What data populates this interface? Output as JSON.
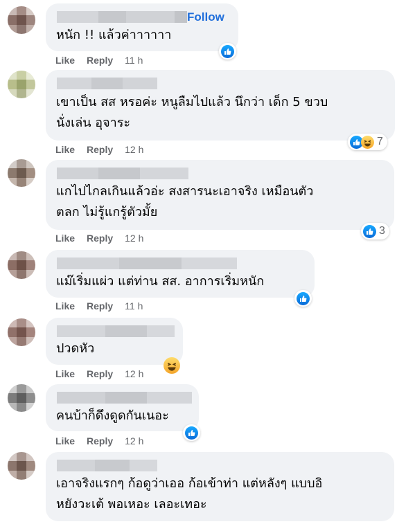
{
  "follow_label": "Follow",
  "comments": [
    {
      "text_lines": [
        "หนัก !! แล้วค่าาาาาา"
      ],
      "like_label": "Like",
      "reply_label": "Reply",
      "time": "11 h",
      "reaction_count": ""
    },
    {
      "text_lines": [
        "เขาเป็น สส หรอค่ะ หนูลืมไปแล้ว นึกว่า เด็ก 5 ขวบ",
        "นั่งเล่น อุจาระ"
      ],
      "like_label": "Like",
      "reply_label": "Reply",
      "time": "12 h",
      "reaction_count": "7"
    },
    {
      "text_lines": [
        "แกไปไกลเกินแล้วอ่ะ สงสารนะเอาจริง เหมือนตัว",
        "ตลก ไม่รู้แกรู้ตัวมั้ย"
      ],
      "like_label": "Like",
      "reply_label": "Reply",
      "time": "12 h",
      "reaction_count": "3"
    },
    {
      "text_lines": [
        "แม๊เริ่มแผ่ว แต่ท่าน สส. อาการเริ่มหนัก"
      ],
      "like_label": "Like",
      "reply_label": "Reply",
      "time": "11 h",
      "reaction_count": ""
    },
    {
      "text_lines": [
        "ปวดหัว"
      ],
      "like_label": "Like",
      "reply_label": "Reply",
      "time": "12 h",
      "reaction_count": ""
    },
    {
      "text_lines": [
        "คนบ้าก็ดึงดูดกันเนอะ"
      ],
      "like_label": "Like",
      "reply_label": "Reply",
      "time": "12 h",
      "reaction_count": ""
    },
    {
      "text_lines": [
        "เอาจริงแรกๆ ก้อดูว่าเออ ก้อเข้าท่า แต่หลังๆ แบบอิ",
        "หยังวะเต้ พอเหอะ เลอะเทอะ"
      ],
      "like_label": "",
      "reply_label": "",
      "time": "",
      "reaction_count": ""
    }
  ]
}
